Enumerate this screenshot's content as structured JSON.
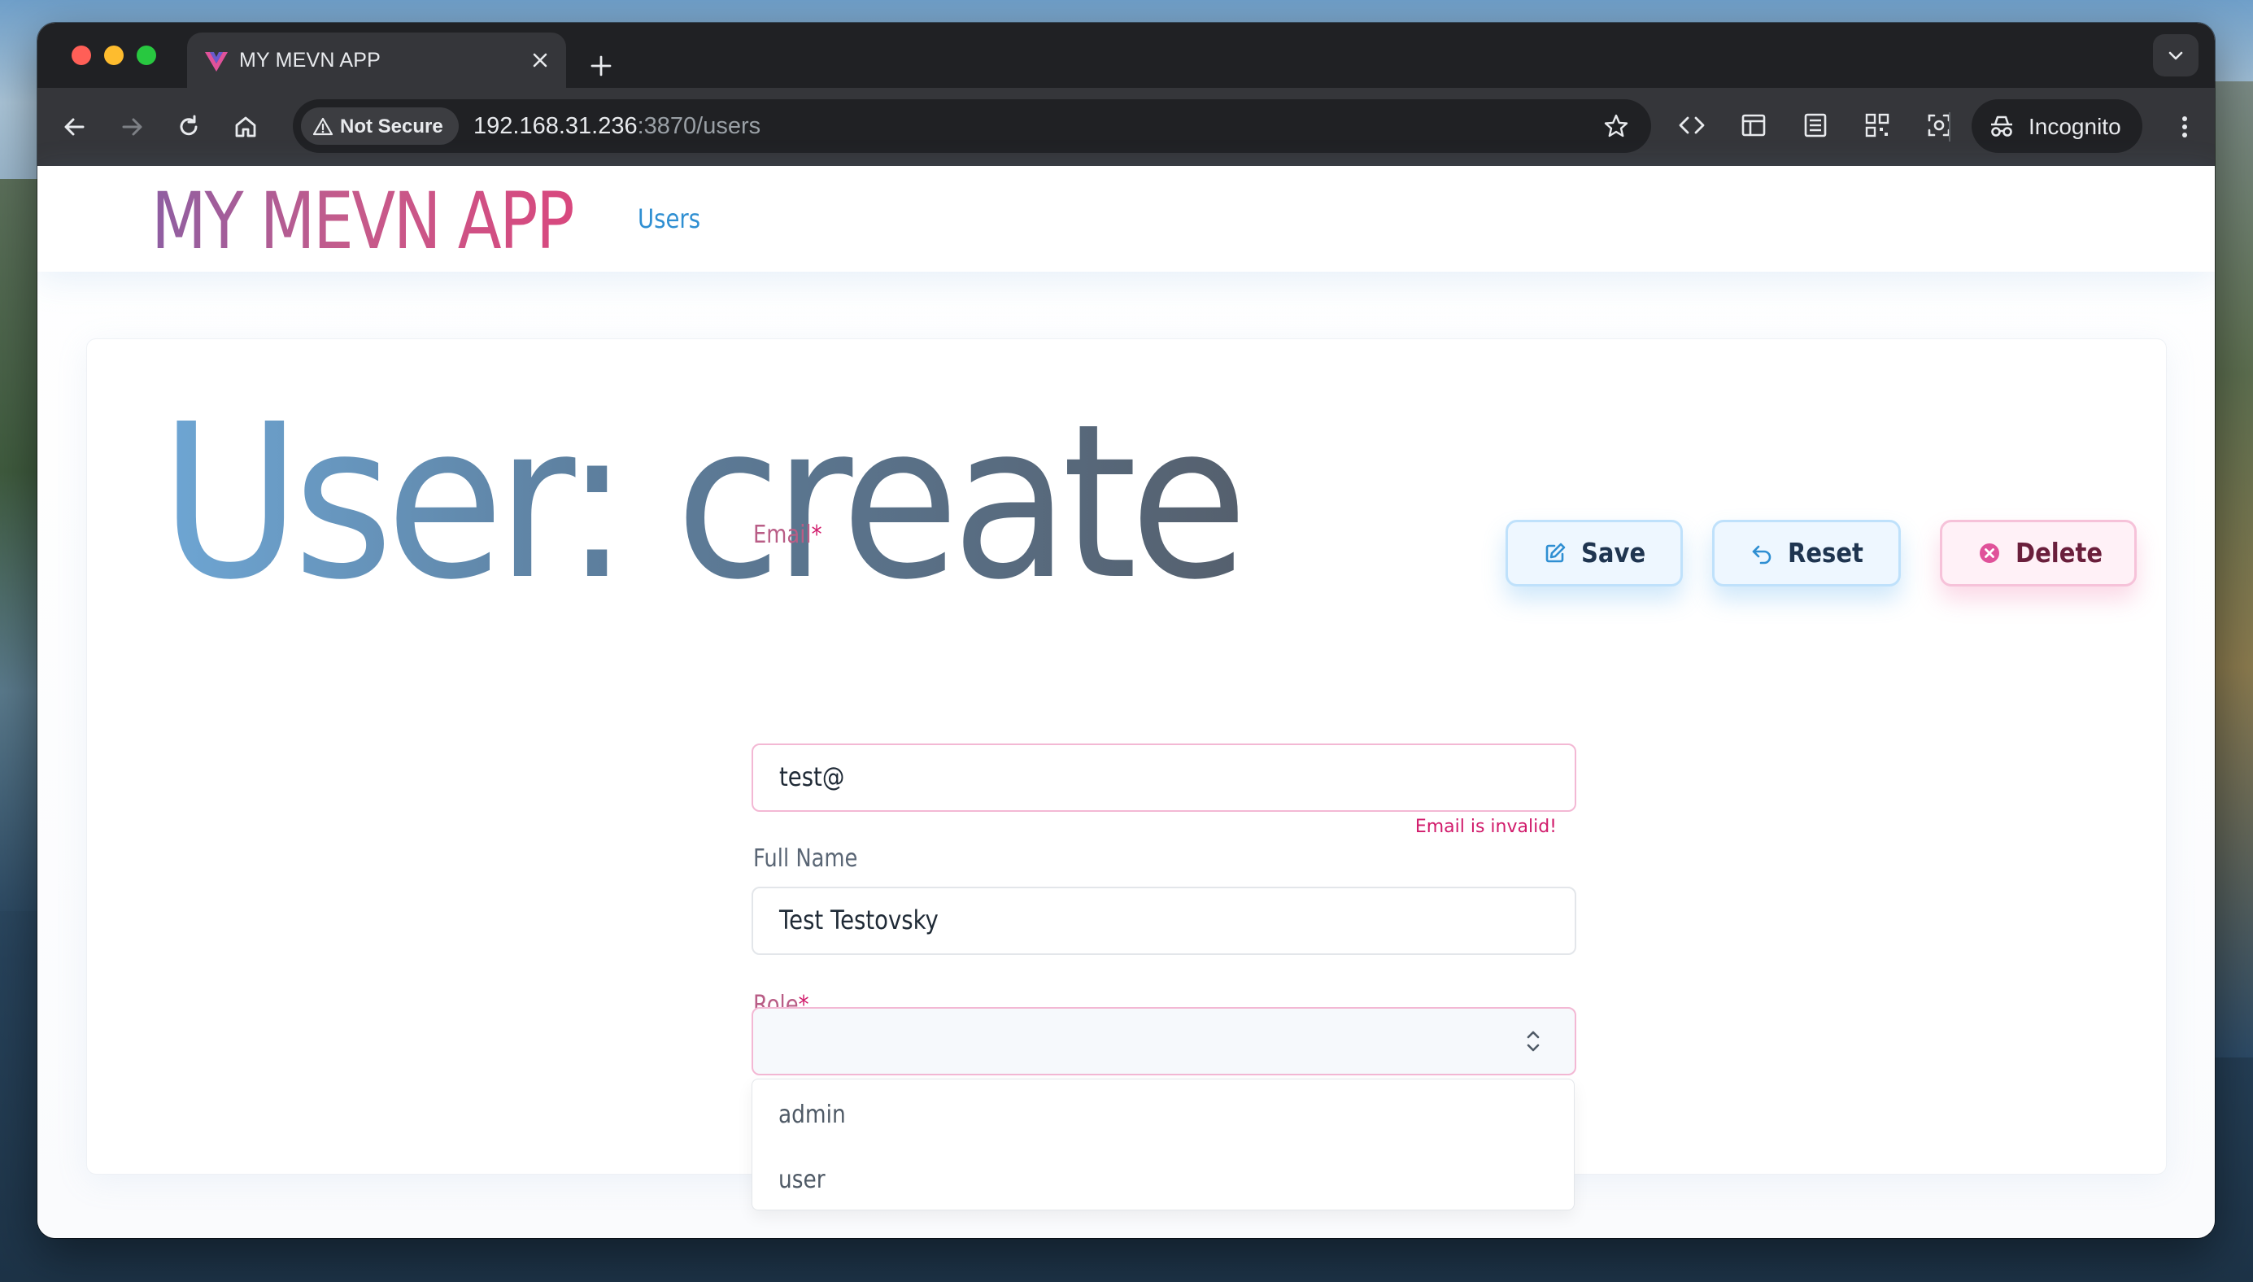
{
  "browser": {
    "tab_title": "MY MEVN APP",
    "security_label": "Not Secure",
    "url_host": "192.168.31.236",
    "url_path": ":3870/users",
    "incognito_label": "Incognito"
  },
  "app": {
    "logo": "MY MEVN APP",
    "nav_users": "Users"
  },
  "page": {
    "title": "User: create"
  },
  "actions": {
    "save": "Save",
    "reset": "Reset",
    "delete": "Delete"
  },
  "form": {
    "email_label": "Email",
    "email_value": "test@",
    "email_error": "Email is invalid!",
    "fullname_label": "Full Name",
    "fullname_value": "Test Testovsky",
    "role_label": "Role",
    "required_mark": "*",
    "role_options": [
      "admin",
      "user"
    ]
  },
  "colors": {
    "accent_blue": "#2f8fd2",
    "error_pink": "#d11b6b",
    "chrome_dark": "#202124"
  }
}
